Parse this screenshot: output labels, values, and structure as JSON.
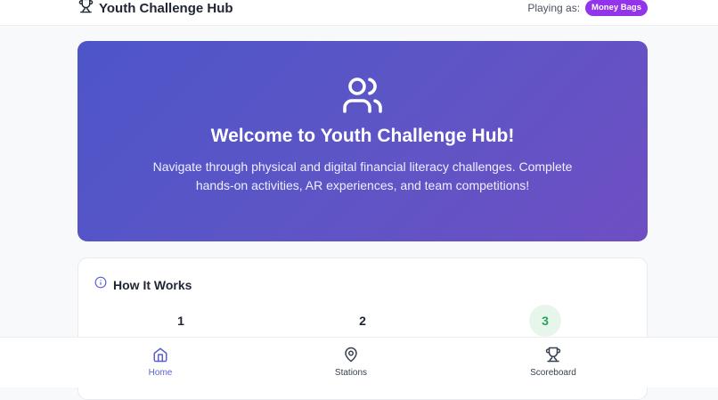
{
  "header": {
    "title": "Youth Challenge Hub",
    "playing_label": "Playing as:",
    "player_name": "Money Bags",
    "player_badge_color": "#9333ea"
  },
  "hero": {
    "icon": "users-icon",
    "title": "Welcome to Youth Challenge Hub!",
    "subtitle": "Navigate through physical and digital financial literacy challenges. Complete hands-on activities, AR experiences, and team competitions!"
  },
  "how_it_works": {
    "icon": "info-icon",
    "title": "How It Works",
    "steps": [
      "1",
      "2",
      "3"
    ]
  },
  "bottom_nav": {
    "items": [
      {
        "label": "Home",
        "icon": "home-icon",
        "active": true
      },
      {
        "label": "Stations",
        "icon": "map-pin-icon",
        "active": false
      },
      {
        "label": "Scoreboard",
        "icon": "trophy-icon",
        "active": false
      }
    ],
    "active_color": "#5b5fd6"
  }
}
